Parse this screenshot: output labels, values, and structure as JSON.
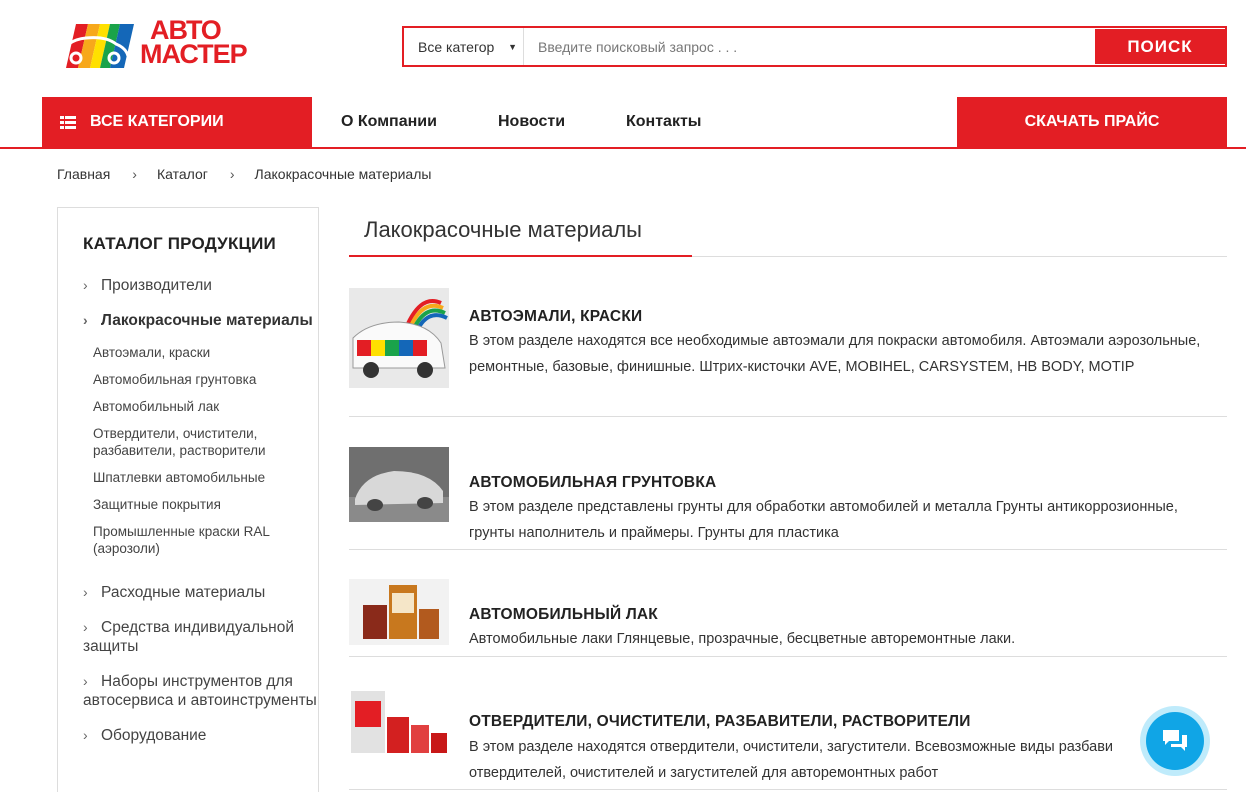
{
  "logo": {
    "line1": "АВТО",
    "line2": "МАСТЕР"
  },
  "search": {
    "category_label": "Все категор",
    "placeholder": "Введите поисковый запрос . . .",
    "button_label": "ПОИСК"
  },
  "nav": {
    "all_categories": "ВСЕ КАТЕГОРИИ",
    "links": [
      "О Компании",
      "Новости",
      "Контакты"
    ],
    "download_price": "СКАЧАТЬ ПРАЙС"
  },
  "breadcrumb": [
    "Главная",
    "Каталог",
    "Лакокрасочные материалы"
  ],
  "sidebar": {
    "title": "КАТАЛОГ ПРОДУКЦИИ",
    "items": [
      "Производители",
      "Лакокрасочные материалы",
      "Расходные материалы",
      "Средства индивидуальной защиты",
      "Наборы инструментов для автосервиса и автоинструменты",
      "Оборудование"
    ],
    "subitems": [
      "Автоэмали, краски",
      "Автомобильная грунтовка",
      "Автомобильный лак",
      "Отвердители, очистители, разбавители, растворители",
      "Шпатлевки автомобильные",
      "Защитные покрытия",
      "Промышленные краски RAL (аэрозоли)"
    ]
  },
  "main": {
    "title": "Лакокрасочные материалы",
    "products": [
      {
        "title": "АВТОЭМАЛИ, КРАСКИ",
        "description": "В этом разделе находятся все необходимые автоэмали для покраски автомобиля. Автоэмали аэрозольные, ремонтные, базовые, финишные. Штрих-кисточки AVE, MOBIHEL, CARSYSTEM, HB BODY, MOTIP"
      },
      {
        "title": "АВТОМОБИЛЬНАЯ ГРУНТОВКА",
        "description": "В этом разделе представлены грунты для обработки автомобилей и металла Грунты антикоррозионные, грунты наполнитель и праймеры. Грунты для пластика"
      },
      {
        "title": "АВТОМОБИЛЬНЫЙ ЛАК",
        "description": "Автомобильные лаки Глянцевые, прозрачные, бесцветные авторемонтные лаки."
      },
      {
        "title": "ОТВЕРДИТЕЛИ, ОЧИСТИТЕЛИ, РАЗБАВИТЕЛИ, РАСТВОРИТЕЛИ",
        "description": "В этом разделе находятся отвердители, очистители, загустители. Всевозможные виды разбави отвердителей, очистителей и загустителей для авторемонтных работ"
      }
    ]
  },
  "colors": {
    "accent": "#e31e24",
    "chat": "#10a5e6"
  },
  "icons": {
    "nav_all": "list-icon",
    "chat": "chat-bubbles-icon",
    "caret": "caret-down-icon",
    "chevron": "chevron-right-icon"
  }
}
